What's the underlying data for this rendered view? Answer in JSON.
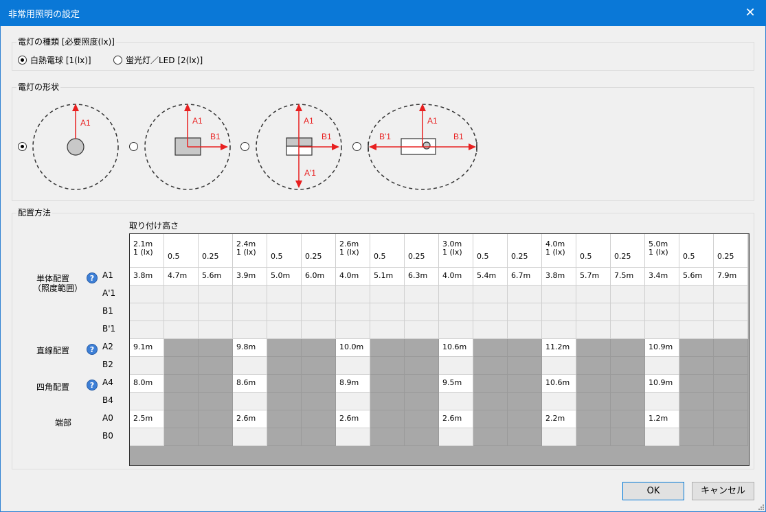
{
  "window": {
    "title": "非常用照明の設定",
    "close_glyph": "✕"
  },
  "lamp_type": {
    "legend": "電灯の種類 [必要照度(lx)]",
    "options": [
      {
        "label": "白熱電球 [1(lx)]",
        "selected": true
      },
      {
        "label": "蛍光灯／LED [2(lx)]",
        "selected": false
      }
    ]
  },
  "lamp_shape": {
    "legend": "電灯の形状",
    "options": [
      {
        "selected": true,
        "labels": [
          "A1"
        ]
      },
      {
        "selected": false,
        "labels": [
          "A1",
          "B1"
        ]
      },
      {
        "selected": false,
        "labels": [
          "A1",
          "B1",
          "A'1"
        ]
      },
      {
        "selected": false,
        "labels": [
          "A1",
          "B1",
          "B'1"
        ]
      }
    ]
  },
  "placement": {
    "legend": "配置方法",
    "height_label": "取り付け高さ",
    "columns": [
      [
        "2.1m",
        "1 (lx)"
      ],
      [
        "0.5"
      ],
      [
        "0.25"
      ],
      [
        "2.4m",
        "1 (lx)"
      ],
      [
        "0.5"
      ],
      [
        "0.25"
      ],
      [
        "2.6m",
        "1 (lx)"
      ],
      [
        "0.5"
      ],
      [
        "0.25"
      ],
      [
        "3.0m",
        "1 (lx)"
      ],
      [
        "0.5"
      ],
      [
        "0.25"
      ],
      [
        "4.0m",
        "1 (lx)"
      ],
      [
        "0.5"
      ],
      [
        "0.25"
      ],
      [
        "5.0m",
        "1 (lx)"
      ],
      [
        "0.5"
      ],
      [
        "0.25"
      ]
    ],
    "groups": [
      {
        "label": "単体配置",
        "sublabel": "（照度範囲）",
        "help": "?"
      },
      {
        "label": "直線配置",
        "help": "?"
      },
      {
        "label": "四角配置",
        "help": "?"
      },
      {
        "label": "端部"
      }
    ],
    "rows": [
      {
        "code": "A1",
        "cells": [
          "3.8m",
          "4.7m",
          "5.6m",
          "3.9m",
          "5.0m",
          "6.0m",
          "4.0m",
          "5.1m",
          "6.3m",
          "4.0m",
          "5.4m",
          "6.7m",
          "3.8m",
          "5.7m",
          "7.5m",
          "3.4m",
          "5.6m",
          "7.9m"
        ]
      },
      {
        "code": "A'1",
        "cells": []
      },
      {
        "code": "B1",
        "cells": []
      },
      {
        "code": "B'1",
        "cells": []
      },
      {
        "code": "A2",
        "cells": [
          "9.1m",
          "",
          "",
          "9.8m",
          "",
          "",
          "10.0m",
          "",
          "",
          "10.6m",
          "",
          "",
          "11.2m",
          "",
          "",
          "10.9m",
          "",
          ""
        ]
      },
      {
        "code": "B2",
        "cells": []
      },
      {
        "code": "A4",
        "cells": [
          "8.0m",
          "",
          "",
          "8.6m",
          "",
          "",
          "8.9m",
          "",
          "",
          "9.5m",
          "",
          "",
          "10.6m",
          "",
          "",
          "10.9m",
          "",
          ""
        ]
      },
      {
        "code": "B4",
        "cells": []
      },
      {
        "code": "A0",
        "cells": [
          "2.5m",
          "",
          "",
          "2.6m",
          "",
          "",
          "2.6m",
          "",
          "",
          "2.6m",
          "",
          "",
          "2.2m",
          "",
          "",
          "1.2m",
          "",
          ""
        ]
      },
      {
        "code": "B0",
        "cells": []
      }
    ]
  },
  "buttons": {
    "ok": "OK",
    "cancel": "キャンセル"
  }
}
